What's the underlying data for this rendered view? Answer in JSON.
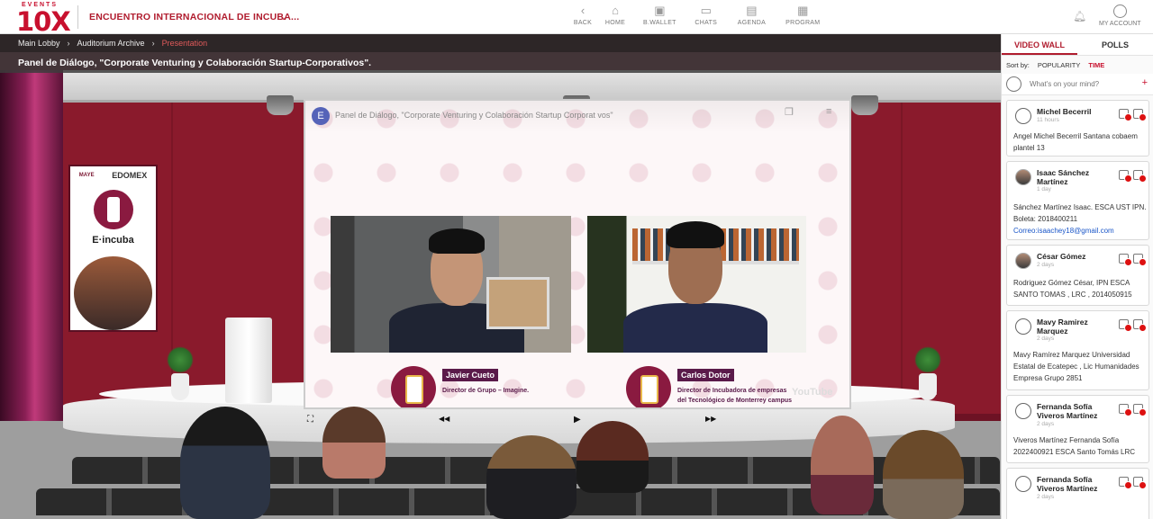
{
  "header": {
    "logo_events": "EVENTS",
    "logo_main": "10X",
    "event_title": "ENCUENTRO INTERNACIONAL DE INCUBA...",
    "nav": [
      {
        "label": "BACK",
        "icon": "chevron-left-icon",
        "glyph": "‹"
      },
      {
        "label": "HOME",
        "icon": "home-icon",
        "glyph": "⌂"
      },
      {
        "label": "B.WALLET",
        "icon": "wallet-icon",
        "glyph": "▣"
      },
      {
        "label": "CHATS",
        "icon": "chat-icon",
        "glyph": "▭"
      },
      {
        "label": "AGENDA",
        "icon": "agenda-icon",
        "glyph": "▤"
      },
      {
        "label": "PROGRAM",
        "icon": "program-icon",
        "glyph": "▦"
      }
    ],
    "my_account": "MY ACCOUNT"
  },
  "breadcrumb": [
    "Main Lobby",
    "Auditorium Archive",
    "Presentation"
  ],
  "page_title": "Panel de Diálogo, \"Corporate Venturing y Colaboración Startup-Corporativos\".",
  "banner": {
    "logos_left": "MAYE",
    "logo_right": "EDOMEX",
    "brand": "E·incuba"
  },
  "video": {
    "channel_initial": "E",
    "title": "Panel de Diálogo, \"Corporate Venturing y Colaboración Startup Corporat vos\"",
    "watermark": "YouTube",
    "speakers": [
      {
        "name": "Javier Cueto",
        "role": "Director de Grupo – Imagine."
      },
      {
        "name": "Carlos Dotor",
        "role": "Director de Incubadora de empresas del Tecnológico de Monterrey campus Toluca."
      }
    ]
  },
  "player": {
    "fullscreen": "⛶",
    "rewind": "◀◀",
    "play": "▶",
    "forward": "▶▶"
  },
  "sidebar": {
    "tabs": [
      "VIDEO WALL",
      "POLLS"
    ],
    "active_tab": 0,
    "sort_label": "Sort by:",
    "sort_options": [
      "POPULARITY",
      "TIME"
    ],
    "active_sort": 1,
    "composer_placeholder": "What's on your mind?",
    "posts": [
      {
        "author": "Michel Becerril",
        "time": "11 hours",
        "body": "Angel Michel Becerril Santana cobaem plantel 13",
        "mail": ""
      },
      {
        "author": "Isaac Sánchez Martínez",
        "time": "1 day",
        "body": "Sánchez Martínez Isaac. ESCA UST IPN. Boleta: 2018400211",
        "mail": "Correo:isaachey18@gmail.com"
      },
      {
        "author": "César Gómez",
        "time": "2 days",
        "body": "Rodriguez Gómez César, IPN ESCA SANTO TOMAS , LRC , 2014050915",
        "mail": ""
      },
      {
        "author": "Mavy Ramirez Marquez",
        "time": "2 days",
        "body": "Mavy Ramírez Marquez Universidad Estatal de Ecatepec , Lic Humanidades Empresa Grupo 2851",
        "mail": ""
      },
      {
        "author": "Fernanda Sofía Viveros Martínez",
        "time": "2 days",
        "body": "Viveros Martínez Fernanda Sofía 2022400921 ESCA Santo Tomás LRC",
        "mail": ""
      },
      {
        "author": "Fernanda Sofía Viveros Martínez",
        "time": "2 days",
        "body": "",
        "mail": ""
      }
    ]
  }
}
